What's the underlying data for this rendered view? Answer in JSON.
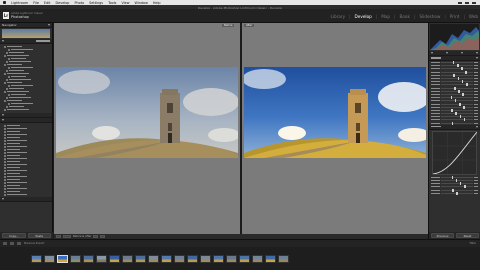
{
  "menubar": {
    "items": [
      "Lightroom",
      "File",
      "Edit",
      "Develop",
      "Photo",
      "Settings",
      "Tools",
      "View",
      "Window",
      "Help"
    ]
  },
  "window": {
    "title": "Develop - Adobe Photoshop Lightroom Classic - Develop"
  },
  "identity": {
    "logo": "Lr",
    "line1": "Adobe Lightroom Classic",
    "line2": "Photoshop"
  },
  "modules": {
    "items": [
      {
        "label": "Library",
        "active": false
      },
      {
        "label": "Develop",
        "active": true
      },
      {
        "label": "Map",
        "active": false
      },
      {
        "label": "Book",
        "active": false
      },
      {
        "label": "Slideshow",
        "active": false
      },
      {
        "label": "Print",
        "active": false
      },
      {
        "label": "Web",
        "active": false
      }
    ]
  },
  "left_panel": {
    "navigator_label": "Navigator",
    "bottom_buttons": [
      "Copy...",
      "Paste"
    ]
  },
  "center": {
    "before_label": "Before",
    "after_label": "After",
    "toolbar_text": "Before & After"
  },
  "right_panel": {
    "bottom_buttons": [
      "Previous",
      "Reset"
    ]
  },
  "filmstrip": {
    "source_text": "Previous Import",
    "count_text": "Filter"
  },
  "colors": {
    "sky": "#3b6ab8",
    "grass": "#c4a35a",
    "tower": "#8a7152"
  }
}
